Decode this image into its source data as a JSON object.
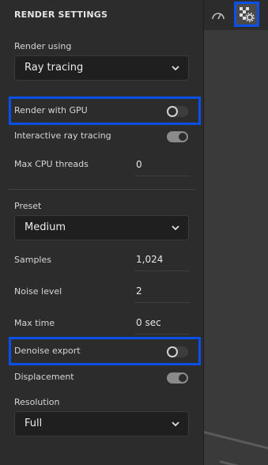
{
  "panel": {
    "title": "RENDER SETTINGS",
    "render_using": {
      "label": "Render using",
      "value": "Ray tracing"
    },
    "render_with_gpu": {
      "label": "Render with GPU",
      "state": "off"
    },
    "interactive_ray_tracing": {
      "label": "Interactive ray tracing",
      "state": "on"
    },
    "max_cpu_threads": {
      "label": "Max CPU threads",
      "value": "0"
    },
    "preset": {
      "label": "Preset",
      "value": "Medium"
    },
    "samples": {
      "label": "Samples",
      "value": "1,024"
    },
    "noise_level": {
      "label": "Noise level",
      "value": "2"
    },
    "max_time": {
      "label": "Max time",
      "value": "0 sec"
    },
    "denoise_export": {
      "label": "Denoise export",
      "state": "off"
    },
    "displacement": {
      "label": "Displacement",
      "state": "on"
    },
    "resolution": {
      "label": "Resolution",
      "value": "Full"
    }
  },
  "toolbar": {
    "icons": [
      "speedometer-icon",
      "render-settings-icon"
    ]
  },
  "colors": {
    "panel_bg": "#2c2c2c",
    "highlight": "#0a4fe8",
    "text": "#d6d6d6"
  }
}
